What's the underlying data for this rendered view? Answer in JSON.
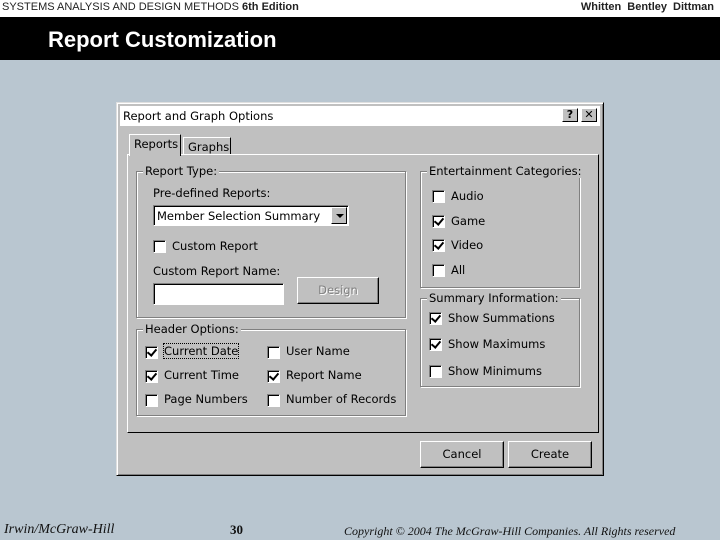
{
  "slide": {
    "header_left_title": "SYSTEMS ANALYSIS AND DESIGN METHODS",
    "header_left_edition": "6th Edition",
    "header_right": "Whitten  Bentley  Dittman",
    "title": "Report Customization",
    "footer_left": "Irwin/McGraw-Hill",
    "footer_page": "30",
    "footer_right": "Copyright © 2004 The McGraw-Hill Companies. All Rights reserved"
  },
  "dialog": {
    "title": "Report and Graph Options",
    "help_button": "?",
    "close_button": "✕",
    "tabs": [
      {
        "label": "Reports",
        "active": true
      },
      {
        "label": "Graphs",
        "active": false
      }
    ],
    "report_type": {
      "legend": "Report Type:",
      "predefined_label": "Pre-defined Reports:",
      "predefined_value": "Member Selection Summary",
      "custom_report": {
        "label": "Custom Report",
        "checked": false
      },
      "custom_name_label": "Custom Report Name:",
      "custom_name_value": "",
      "design_button": "Design"
    },
    "header_options": {
      "legend": "Header Options:",
      "items": [
        {
          "label": "Current Date",
          "checked": true
        },
        {
          "label": "User Name",
          "checked": false
        },
        {
          "label": "Current Time",
          "checked": true
        },
        {
          "label": "Report Name",
          "checked": true
        },
        {
          "label": "Page Numbers",
          "checked": false
        },
        {
          "label": "Number of Records",
          "checked": false
        }
      ]
    },
    "entertainment": {
      "legend": "Entertainment Categories:",
      "items": [
        {
          "label": "Audio",
          "checked": false
        },
        {
          "label": "Game",
          "checked": true
        },
        {
          "label": "Video",
          "checked": true
        },
        {
          "label": "All",
          "checked": false
        }
      ]
    },
    "summary": {
      "legend": "Summary Information:",
      "items": [
        {
          "label": "Show Summations",
          "checked": true
        },
        {
          "label": "Show Maximums",
          "checked": true
        },
        {
          "label": "Show Minimums",
          "checked": false
        }
      ]
    },
    "cancel_button": "Cancel",
    "create_button": "Create"
  }
}
